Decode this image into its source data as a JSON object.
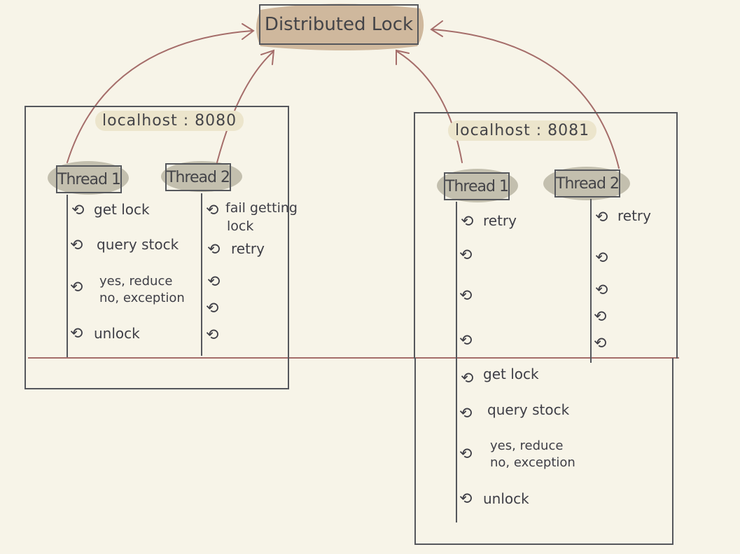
{
  "title": "Distributed  Lock",
  "servers": [
    {
      "host": "localhost : 8080",
      "threads": [
        {
          "name": "Thread 1",
          "steps": [
            "get lock",
            "query stock",
            "yes, reduce",
            "no, exception",
            "unlock"
          ]
        },
        {
          "name": "Thread 2",
          "steps": [
            "fail getting",
            "lock",
            "retry"
          ]
        }
      ]
    },
    {
      "host": "localhost : 8081",
      "threads": [
        {
          "name": "Thread 1",
          "steps": [
            "retry",
            "get lock",
            "query stock",
            "yes, reduce",
            "no, exception",
            "unlock"
          ]
        },
        {
          "name": "Thread 2",
          "steps": [
            "retry"
          ]
        }
      ]
    }
  ],
  "colors": {
    "background": "#f7f4e8",
    "title_fill": "#cfb89d",
    "thread_fill": "#c3bfae",
    "host_fill": "#ece5cc",
    "arrow": "#a56d6a",
    "ink": "#55575c"
  },
  "icons": {
    "step_marker": "loop-arrow-icon"
  }
}
